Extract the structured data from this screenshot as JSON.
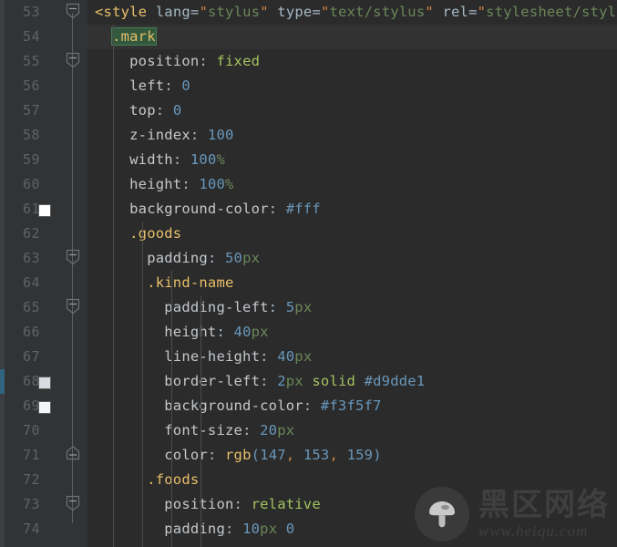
{
  "editor": {
    "name": "code-editor",
    "language": "vue-html-stylus",
    "theme": "darcula",
    "colors": {
      "background": "#2b2b2b",
      "gutter_background": "#313335",
      "line_number": "#606366",
      "current_line_highlight": "#323232",
      "occurrence_highlight": "#32593d",
      "vcs_changed_marker": "#2f6580",
      "indent_guide": "#4b4b4b"
    },
    "first_line_number": 53,
    "last_line_number": 74
  },
  "lines": [
    {
      "number": "53",
      "fold": "collapse",
      "swatch": null,
      "highlight": false,
      "vcs": false,
      "text": "<style lang=\"stylus\" type=\"text/stylus\" rel=\"stylesheet/stylus\">"
    },
    {
      "number": "54",
      "fold": null,
      "swatch": null,
      "highlight": true,
      "vcs": false,
      "text": "  .mark"
    },
    {
      "number": "55",
      "fold": "collapse",
      "swatch": null,
      "highlight": false,
      "vcs": false,
      "text": "    position: fixed"
    },
    {
      "number": "56",
      "fold": null,
      "swatch": null,
      "highlight": false,
      "vcs": false,
      "text": "    left: 0"
    },
    {
      "number": "57",
      "fold": null,
      "swatch": null,
      "highlight": false,
      "vcs": false,
      "text": "    top: 0"
    },
    {
      "number": "58",
      "fold": null,
      "swatch": null,
      "highlight": false,
      "vcs": false,
      "text": "    z-index: 100"
    },
    {
      "number": "59",
      "fold": null,
      "swatch": null,
      "highlight": false,
      "vcs": false,
      "text": "    width: 100%"
    },
    {
      "number": "60",
      "fold": null,
      "swatch": null,
      "highlight": false,
      "vcs": false,
      "text": "    height: 100%"
    },
    {
      "number": "61",
      "fold": null,
      "swatch": "#ffffff",
      "highlight": false,
      "vcs": false,
      "text": "    background-color: #fff"
    },
    {
      "number": "62",
      "fold": null,
      "swatch": null,
      "highlight": false,
      "vcs": false,
      "text": "    .goods"
    },
    {
      "number": "63",
      "fold": "collapse",
      "swatch": null,
      "highlight": false,
      "vcs": false,
      "text": "      padding: 50px"
    },
    {
      "number": "64",
      "fold": null,
      "swatch": null,
      "highlight": false,
      "vcs": false,
      "text": "      .kind-name"
    },
    {
      "number": "65",
      "fold": "collapse",
      "swatch": null,
      "highlight": false,
      "vcs": false,
      "text": "        padding-left: 5px"
    },
    {
      "number": "66",
      "fold": null,
      "swatch": null,
      "highlight": false,
      "vcs": false,
      "text": "        height: 40px"
    },
    {
      "number": "67",
      "fold": null,
      "swatch": null,
      "highlight": false,
      "vcs": false,
      "text": "        line-height: 40px"
    },
    {
      "number": "68",
      "fold": null,
      "swatch": "#d9dde1",
      "highlight": false,
      "vcs": true,
      "text": "        border-left: 2px solid #d9dde1"
    },
    {
      "number": "69",
      "fold": null,
      "swatch": "#f3f5f7",
      "highlight": false,
      "vcs": false,
      "text": "        background-color: #f3f5f7"
    },
    {
      "number": "70",
      "fold": null,
      "swatch": null,
      "highlight": false,
      "vcs": false,
      "text": "        font-size: 20px"
    },
    {
      "number": "71",
      "fold": "expand",
      "swatch": null,
      "highlight": false,
      "vcs": false,
      "text": "        color: rgb(147, 153, 159)"
    },
    {
      "number": "72",
      "fold": null,
      "swatch": null,
      "highlight": false,
      "vcs": false,
      "text": "      .foods"
    },
    {
      "number": "73",
      "fold": "collapse",
      "swatch": null,
      "highlight": false,
      "vcs": false,
      "text": "        position: relative"
    },
    {
      "number": "74",
      "fold": null,
      "swatch": null,
      "highlight": false,
      "vcs": false,
      "text": "        padding: 10px 0"
    }
  ],
  "watermark": {
    "brand_cn": "黑区网络",
    "url": "www.heiqu.com",
    "logo_icon": "mushroom-icon"
  }
}
